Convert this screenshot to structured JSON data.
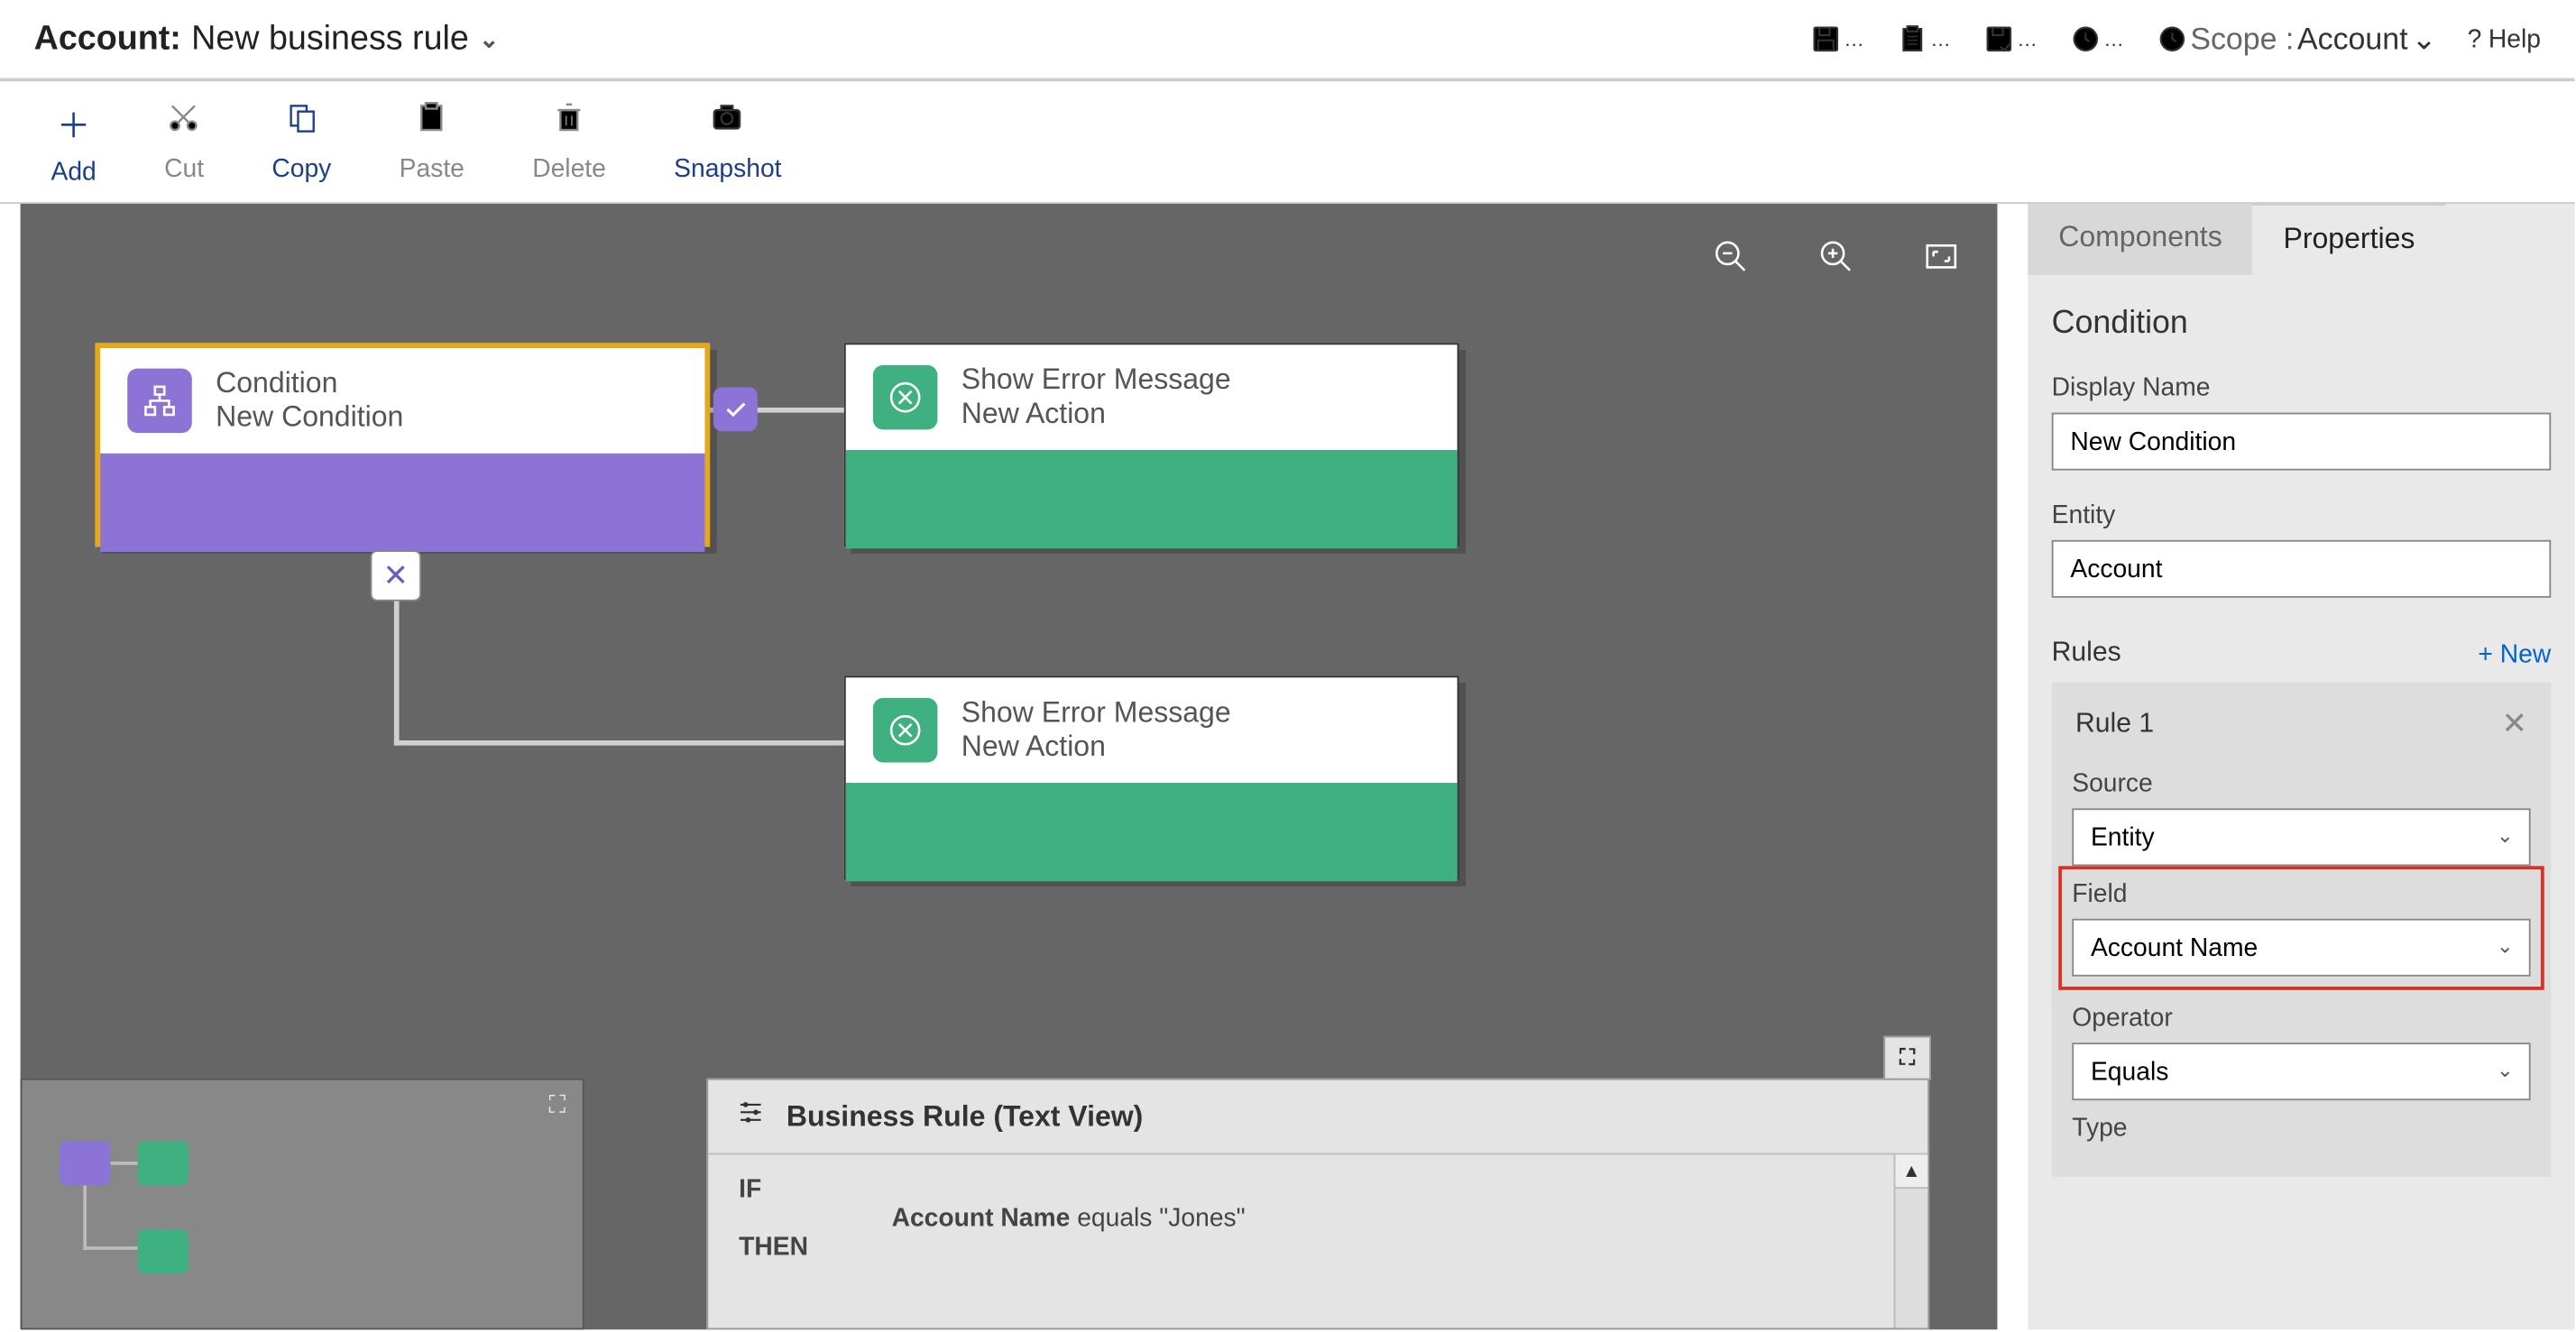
{
  "header": {
    "entity": "Account:",
    "rule_name": "New business rule",
    "scope_label": "Scope :",
    "scope_value": "Account",
    "help": "Help"
  },
  "toolbar": {
    "add": "Add",
    "cut": "Cut",
    "copy": "Copy",
    "paste": "Paste",
    "delete": "Delete",
    "snapshot": "Snapshot"
  },
  "canvas": {
    "condition_node": {
      "title": "Condition",
      "subtitle": "New Condition"
    },
    "action1": {
      "title": "Show Error Message",
      "subtitle": "New Action"
    },
    "action2": {
      "title": "Show Error Message",
      "subtitle": "New Action"
    }
  },
  "textview": {
    "title": "Business Rule (Text View)",
    "if": "IF",
    "then": "THEN",
    "cond_field": "Account Name",
    "cond_rest": " equals \"Jones\""
  },
  "side": {
    "tab_components": "Components",
    "tab_properties": "Properties",
    "section_title": "Condition",
    "display_name_label": "Display Name",
    "display_name_value": "New Condition",
    "entity_label": "Entity",
    "entity_value": "Account",
    "rules_label": "Rules",
    "new_label": "+  New",
    "rule1_title": "Rule 1",
    "source_label": "Source",
    "source_value": "Entity",
    "field_label": "Field",
    "field_value": "Account Name",
    "operator_label": "Operator",
    "operator_value": "Equals",
    "type_label": "Type"
  }
}
